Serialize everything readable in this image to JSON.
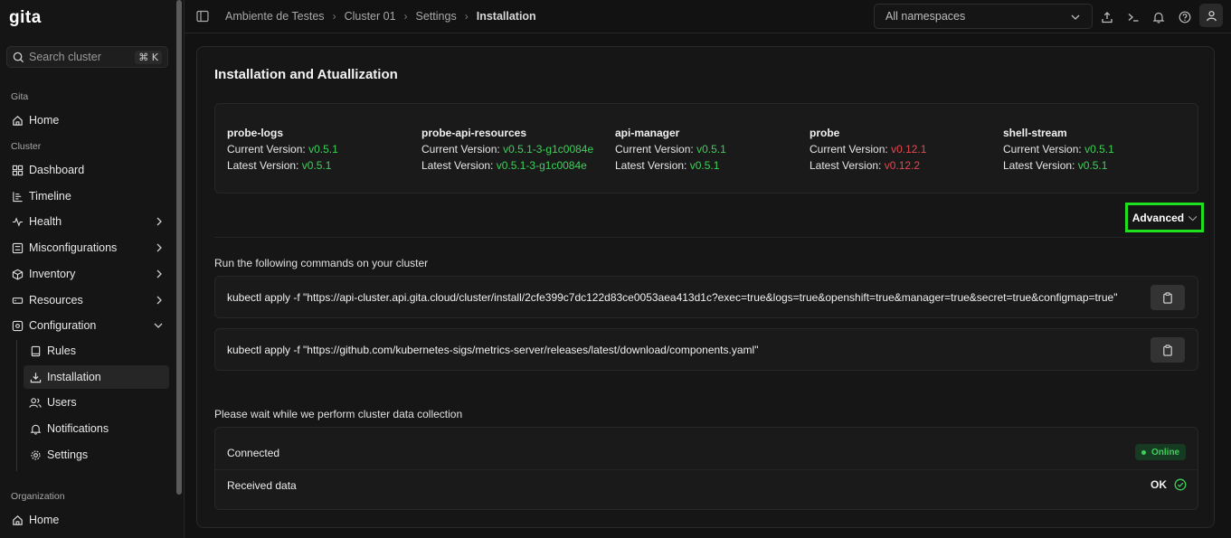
{
  "app": {
    "logo": "gita"
  },
  "sidebar": {
    "search": {
      "placeholder": "Search cluster",
      "shortcut": "⌘ K"
    },
    "sections": {
      "gita": "Gita",
      "cluster": "Cluster",
      "organization": "Organization"
    },
    "items": {
      "home": "Home",
      "dashboard": "Dashboard",
      "timeline": "Timeline",
      "health": "Health",
      "misconfigurations": "Misconfigurations",
      "inventory": "Inventory",
      "resources": "Resources",
      "configuration": "Configuration",
      "rules": "Rules",
      "installation": "Installation",
      "users": "Users",
      "notifications": "Notifications",
      "settings": "Settings",
      "org_home": "Home"
    }
  },
  "header": {
    "breadcrumb": [
      "Ambiente de Testes",
      "Cluster 01",
      "Settings",
      "Installation"
    ],
    "namespace": "All namespaces"
  },
  "main": {
    "title": "Installation and Atuallization",
    "components": [
      {
        "name": "probe-logs",
        "current_label": "Current Version:",
        "current": "v0.5.1",
        "latest_label": "Latest Version:",
        "latest": "v0.5.1",
        "current_status": "green",
        "latest_status": "green"
      },
      {
        "name": "probe-api-resources",
        "current_label": "Current Version:",
        "current": "v0.5.1-3-g1c0084e",
        "latest_label": "Latest Version:",
        "latest": "v0.5.1-3-g1c0084e",
        "current_status": "green",
        "latest_status": "green"
      },
      {
        "name": "api-manager",
        "current_label": "Current Version:",
        "current": "v0.5.1",
        "latest_label": "Latest Version:",
        "latest": "v0.5.1",
        "current_status": "green",
        "latest_status": "green"
      },
      {
        "name": "probe",
        "current_label": "Current Version:",
        "current": "v0.12.1",
        "latest_label": "Latest Version:",
        "latest": "v0.12.2",
        "current_status": "red",
        "latest_status": "red"
      },
      {
        "name": "shell-stream",
        "current_label": "Current Version:",
        "current": "v0.5.1",
        "latest_label": "Latest Version:",
        "latest": "v0.5.1",
        "current_status": "green",
        "latest_status": "green"
      }
    ],
    "advanced_label": "Advanced",
    "run_label": "Run the following commands on your cluster",
    "commands": [
      "kubectl apply -f \"https://api-cluster.api.gita.cloud/cluster/install/2cfe399c7dc122d83ce0053aea413d1c?exec=true&logs=true&openshift=true&manager=true&secret=true&configmap=true\"",
      "kubectl apply -f \"https://github.com/kubernetes-sigs/metrics-server/releases/latest/download/components.yaml\""
    ],
    "wait_label": "Please wait while we perform cluster data collection",
    "status": {
      "connected_label": "Connected",
      "connected_badge": "Online",
      "received_label": "Received data",
      "received_value": "OK"
    }
  },
  "colors": {
    "accent_green": "#3ecf5a",
    "alert_red": "#e5484d",
    "highlight": "#1ee01e"
  }
}
